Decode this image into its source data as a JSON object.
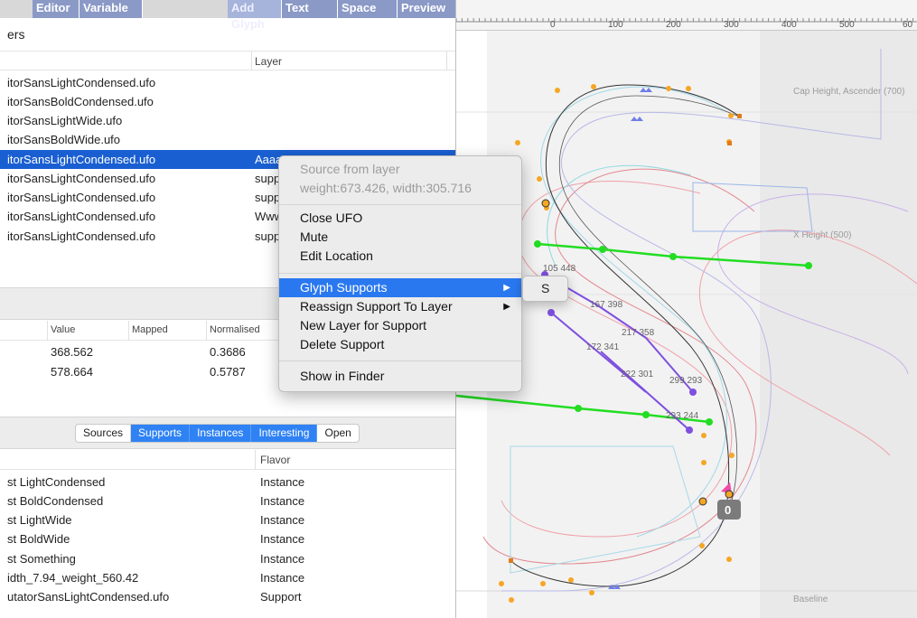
{
  "toolbar": {
    "tabs": [
      "Editor",
      "Variable",
      "Add Glyph",
      "Text",
      "Space",
      "Preview"
    ]
  },
  "masters": {
    "title": "ers",
    "col_layer": "Layer",
    "rows": [
      {
        "name": "itorSansLightCondensed.ufo",
        "layer": ""
      },
      {
        "name": "itorSansBoldCondensed.ufo",
        "layer": ""
      },
      {
        "name": "itorSansLightWide.ufo",
        "layer": ""
      },
      {
        "name": "itorSansBoldWide.ufo",
        "layer": ""
      },
      {
        "name": "itorSansLightCondensed.ufo",
        "layer": "Aaaa"
      },
      {
        "name": "itorSansLightCondensed.ufo",
        "layer": "supp"
      },
      {
        "name": "itorSansLightCondensed.ufo",
        "layer": "supp"
      },
      {
        "name": "itorSansLightCondensed.ufo",
        "layer": "Www"
      },
      {
        "name": "itorSansLightCondensed.ufo",
        "layer": "supp"
      }
    ]
  },
  "axes": {
    "headers": [
      "Value",
      "Mapped",
      "Normalised"
    ],
    "rows": [
      {
        "value": "368.562",
        "mapped": "",
        "normalised": "0.3686"
      },
      {
        "value": "578.664",
        "mapped": "",
        "normalised": "0.5787"
      }
    ]
  },
  "segmented": [
    "Sources",
    "Supports",
    "Instances",
    "Interesting",
    "Open"
  ],
  "instances": {
    "col_flavor": "Flavor",
    "rows": [
      {
        "name": "st LightCondensed",
        "flavor": "Instance"
      },
      {
        "name": "st BoldCondensed",
        "flavor": "Instance"
      },
      {
        "name": "st LightWide",
        "flavor": "Instance"
      },
      {
        "name": "st BoldWide",
        "flavor": "Instance"
      },
      {
        "name": "st Something",
        "flavor": "Instance"
      },
      {
        "name": "idth_7.94_weight_560.42",
        "flavor": "Instance"
      },
      {
        "name": "utatorSansLightCondensed.ufo",
        "flavor": "Support"
      }
    ]
  },
  "ruler": {
    "ticks": [
      "0",
      "100",
      "200",
      "300",
      "400",
      "500",
      "60"
    ]
  },
  "canvas": {
    "guides": [
      "Cap Height, Ascender (700)",
      "X Height (500)",
      "Baseline"
    ],
    "point_labels": [
      "105 448",
      "167 398",
      "217 358",
      "172 341",
      "222 301",
      "299 293",
      "293 244"
    ],
    "selected_point_badge": "0"
  },
  "context_menu": {
    "header_1": "Source from layer",
    "header_2": "weight:673.426, width:305.716",
    "close_ufo": "Close UFO",
    "mute": "Mute",
    "edit_location": "Edit Location",
    "glyph_supports": "Glyph Supports",
    "reassign": "Reassign Support To Layer",
    "new_layer": "New Layer for Support",
    "delete": "Delete Support",
    "show_finder": "Show in Finder",
    "submenu_item": "S"
  },
  "colors": {
    "selection": "#1a5fd1",
    "menu_highlight": "#2a78f0",
    "toolbar_tab": "#8a99c6",
    "green_line": "#22dd22",
    "purple_arrow": "#7e4fe0",
    "orange_point": "#f5a623"
  }
}
